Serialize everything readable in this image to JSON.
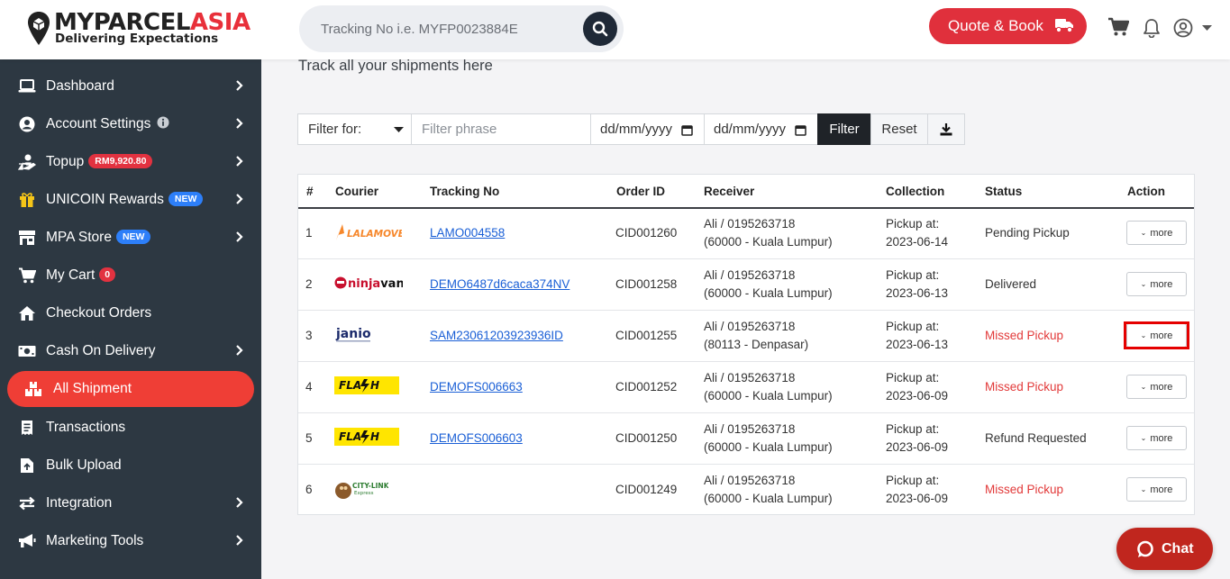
{
  "header": {
    "brand_main": "MYPARCEL",
    "brand_accent": "ASIA",
    "tagline": "Delivering Expectations",
    "search_placeholder": "Tracking No i.e. MYFP0023884E",
    "quote_button": "Quote & Book",
    "icons": [
      "search-icon",
      "truck-icon",
      "cart-icon",
      "bell-icon",
      "user-circle-icon",
      "caret-down-icon"
    ],
    "accent_color": "#e0303c"
  },
  "sidebar": {
    "background": "#2d3842",
    "active_color": "#ef3e36",
    "items": [
      {
        "label": "Dashboard",
        "icon": "laptop-icon",
        "chevron": true
      },
      {
        "label": "Account Settings",
        "icon": "user-circle-icon",
        "chevron": true,
        "info": true
      },
      {
        "label": "Topup",
        "icon": "hand-coin-icon",
        "chevron": true,
        "badge": "RM9,920.80"
      },
      {
        "label": "UNICOIN Rewards",
        "icon": "gift-icon",
        "chevron": true,
        "badge": "NEW"
      },
      {
        "label": "MPA Store",
        "icon": "store-icon",
        "chevron": true,
        "badge": "NEW"
      },
      {
        "label": "My Cart",
        "icon": "cart-icon",
        "chevron": false,
        "badge": "0"
      },
      {
        "label": "Checkout Orders",
        "icon": "home-icon",
        "chevron": false
      },
      {
        "label": "Cash On Delivery",
        "icon": "money-icon",
        "chevron": true
      },
      {
        "label": "All Shipment",
        "icon": "boxes-icon",
        "chevron": false,
        "active": true
      },
      {
        "label": "Transactions",
        "icon": "receipt-icon",
        "chevron": false
      },
      {
        "label": "Bulk Upload",
        "icon": "file-upload-icon",
        "chevron": false
      },
      {
        "label": "Integration",
        "icon": "exchange-icon",
        "chevron": true
      },
      {
        "label": "Marketing Tools",
        "icon": "megaphone-icon",
        "chevron": true
      }
    ]
  },
  "main": {
    "subtitle": "Track all your shipments here",
    "filter": {
      "select_label": "Filter for:",
      "phrase_placeholder": "Filter phrase",
      "date_from": "dd/mm/yyyy",
      "date_to": "dd/mm/yyyy",
      "filter_button": "Filter",
      "reset_button": "Reset"
    },
    "table": {
      "headers": [
        "#",
        "Courier",
        "Tracking No",
        "Order ID",
        "Receiver",
        "Collection",
        "Status",
        "Action"
      ],
      "rows": [
        {
          "no": "1",
          "courier": "LALAMOVE",
          "tracking": "LAMO004558",
          "order_id": "CID001260",
          "receiver_1": "Ali / 0195263718",
          "receiver_2": "(60000 - Kuala Lumpur)",
          "collection_1": "Pickup at:",
          "collection_2": "2023-06-14",
          "status": "Pending Pickup",
          "status_type": "normal",
          "action": "more"
        },
        {
          "no": "2",
          "courier": "ninjavan",
          "tracking": "DEMO6487d6caca374NV",
          "order_id": "CID001258",
          "receiver_1": "Ali / 0195263718",
          "receiver_2": "(60000 - Kuala Lumpur)",
          "collection_1": "Pickup at:",
          "collection_2": "2023-06-13",
          "status": "Delivered",
          "status_type": "normal",
          "action": "more"
        },
        {
          "no": "3",
          "courier": "janio",
          "tracking": "SAM23061203923936ID",
          "order_id": "CID001255",
          "receiver_1": "Ali / 0195263718",
          "receiver_2": "(80113 - Denpasar)",
          "collection_1": "Pickup at:",
          "collection_2": "2023-06-13",
          "status": "Missed Pickup",
          "status_type": "missed",
          "action": "more",
          "highlighted": true
        },
        {
          "no": "4",
          "courier": "FLASH",
          "tracking": "DEMOFS006663",
          "order_id": "CID001252",
          "receiver_1": "Ali / 0195263718",
          "receiver_2": "(60000 - Kuala Lumpur)",
          "collection_1": "Pickup at:",
          "collection_2": "2023-06-09",
          "status": "Missed Pickup",
          "status_type": "missed",
          "action": "more"
        },
        {
          "no": "5",
          "courier": "FLASH",
          "tracking": "DEMOFS006603",
          "order_id": "CID001250",
          "receiver_1": "Ali / 0195263718",
          "receiver_2": "(60000 - Kuala Lumpur)",
          "collection_1": "Pickup at:",
          "collection_2": "2023-06-09",
          "status": "Refund Requested",
          "status_type": "normal",
          "action": "more"
        },
        {
          "no": "6",
          "courier": "CITY-LINK",
          "tracking": "",
          "order_id": "CID001249",
          "receiver_1": "Ali / 0195263718",
          "receiver_2": "(60000 - Kuala Lumpur)",
          "collection_1": "Pickup at:",
          "collection_2": "2023-06-09",
          "status": "Missed Pickup",
          "status_type": "missed",
          "action": "more"
        }
      ]
    }
  },
  "chat": {
    "label": "Chat",
    "icon": "chat-bubble-icon"
  }
}
